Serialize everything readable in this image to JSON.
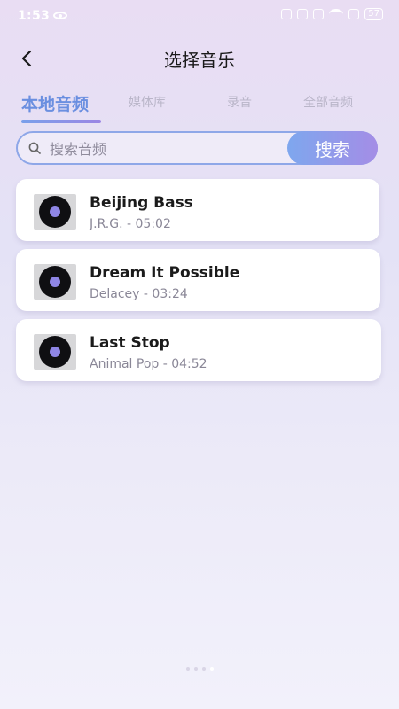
{
  "status_bar": {
    "time": "1:53",
    "battery": "57"
  },
  "header": {
    "title": "选择音乐"
  },
  "tabs": [
    {
      "label": "本地音频"
    },
    {
      "label": "媒体库"
    },
    {
      "label": "录音"
    },
    {
      "label": "全部音频"
    }
  ],
  "active_tab": "本地音频",
  "search": {
    "placeholder": "搜索音频",
    "button_label": "搜索"
  },
  "songs": [
    {
      "title": "Beijing Bass",
      "meta": "J.R.G. - 05:02"
    },
    {
      "title": "Dream It Possible",
      "meta": "Delacey - 03:24"
    },
    {
      "title": "Last Stop",
      "meta": "Animal Pop - 04:52"
    }
  ],
  "icons": [
    "back-arrow-icon",
    "search-icon",
    "vinyl-record-icon",
    "eye-icon",
    "wifi-icon",
    "battery-icon"
  ],
  "colors": {
    "accent": "#6b8fe0",
    "search_button_from": "#7ea7ee",
    "search_button_to": "#a48de6"
  }
}
